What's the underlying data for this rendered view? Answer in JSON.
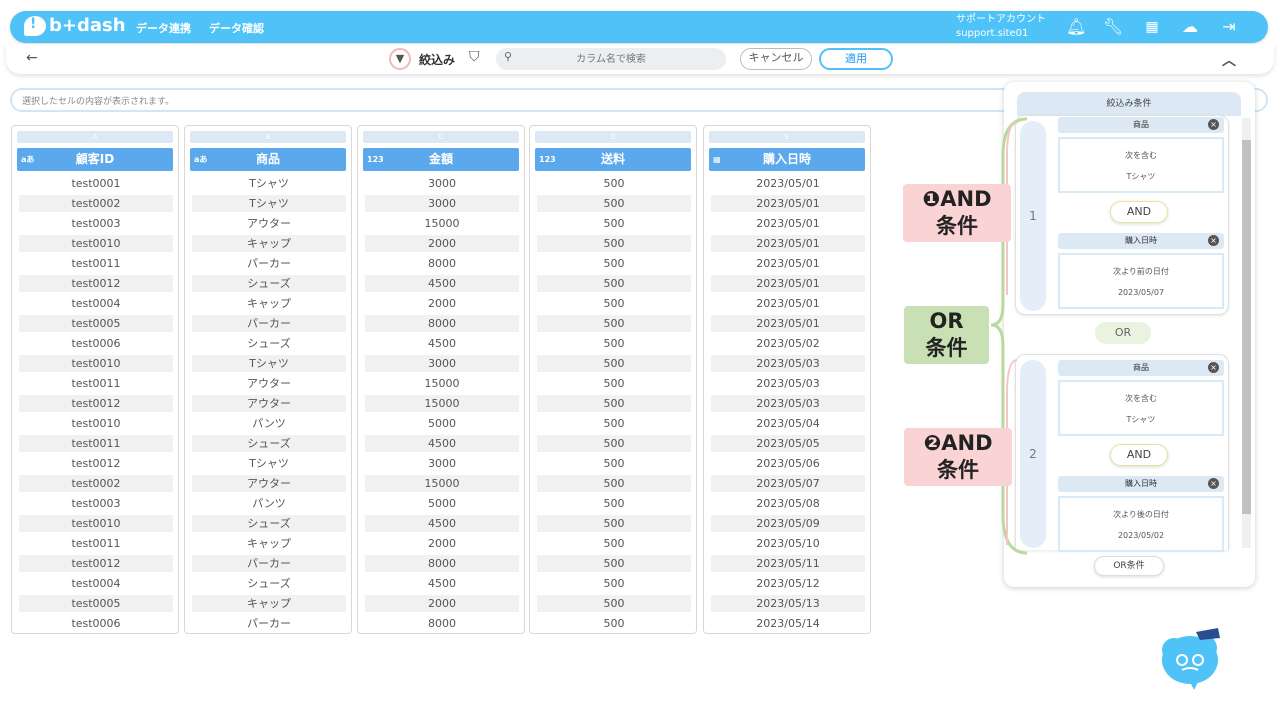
{
  "header": {
    "logo": "b+dash",
    "nav": [
      "データ連携",
      "データ確認"
    ],
    "account_label": "サポートアカウント",
    "account_id": "support.site01"
  },
  "toolbar": {
    "back": "←",
    "filter_label": "絞込み",
    "search_placeholder": "カラム名で検索",
    "cancel": "キャンセル",
    "apply": "適用",
    "collapse": "⌃"
  },
  "cell_bar": "選択したセルの内容が表示されます。",
  "columns": [
    {
      "letter": "A",
      "type": "aあ",
      "name": "顧客ID"
    },
    {
      "letter": "B",
      "type": "aあ",
      "name": "商品"
    },
    {
      "letter": "C",
      "type": "123",
      "name": "金額"
    },
    {
      "letter": "D",
      "type": "123",
      "name": "送料"
    },
    {
      "letter": "E",
      "type": "▦",
      "name": "購入日時"
    }
  ],
  "rows": [
    [
      "test0001",
      "Tシャツ",
      "3000",
      "500",
      "2023/05/01"
    ],
    [
      "test0002",
      "Tシャツ",
      "3000",
      "500",
      "2023/05/01"
    ],
    [
      "test0003",
      "アウター",
      "15000",
      "500",
      "2023/05/01"
    ],
    [
      "test0010",
      "キャップ",
      "2000",
      "500",
      "2023/05/01"
    ],
    [
      "test0011",
      "パーカー",
      "8000",
      "500",
      "2023/05/01"
    ],
    [
      "test0012",
      "シューズ",
      "4500",
      "500",
      "2023/05/01"
    ],
    [
      "test0004",
      "キャップ",
      "2000",
      "500",
      "2023/05/01"
    ],
    [
      "test0005",
      "パーカー",
      "8000",
      "500",
      "2023/05/01"
    ],
    [
      "test0006",
      "シューズ",
      "4500",
      "500",
      "2023/05/02"
    ],
    [
      "test0010",
      "Tシャツ",
      "3000",
      "500",
      "2023/05/03"
    ],
    [
      "test0011",
      "アウター",
      "15000",
      "500",
      "2023/05/03"
    ],
    [
      "test0012",
      "アウター",
      "15000",
      "500",
      "2023/05/03"
    ],
    [
      "test0010",
      "パンツ",
      "5000",
      "500",
      "2023/05/04"
    ],
    [
      "test0011",
      "シューズ",
      "4500",
      "500",
      "2023/05/05"
    ],
    [
      "test0012",
      "Tシャツ",
      "3000",
      "500",
      "2023/05/06"
    ],
    [
      "test0002",
      "アウター",
      "15000",
      "500",
      "2023/05/07"
    ],
    [
      "test0003",
      "パンツ",
      "5000",
      "500",
      "2023/05/08"
    ],
    [
      "test0010",
      "シューズ",
      "4500",
      "500",
      "2023/05/09"
    ],
    [
      "test0011",
      "キャップ",
      "2000",
      "500",
      "2023/05/10"
    ],
    [
      "test0012",
      "パーカー",
      "8000",
      "500",
      "2023/05/11"
    ],
    [
      "test0004",
      "シューズ",
      "4500",
      "500",
      "2023/05/12"
    ],
    [
      "test0005",
      "キャップ",
      "2000",
      "500",
      "2023/05/13"
    ],
    [
      "test0006",
      "パーカー",
      "8000",
      "500",
      "2023/05/14"
    ]
  ],
  "panel": {
    "title": "絞込み条件",
    "group1": {
      "num": "1",
      "c1_field": "商品",
      "c1_op": "次を含む",
      "c1_val": "Tシャツ",
      "and": "AND",
      "c2_field": "購入日時",
      "c2_op": "次より前の日付",
      "c2_val": "2023/05/07"
    },
    "or": "OR",
    "group2": {
      "num": "2",
      "c1_field": "商品",
      "c1_op": "次を含む",
      "c1_val": "Tシャツ",
      "and": "AND",
      "c2_field": "購入日時",
      "c2_op": "次より後の日付",
      "c2_val": "2023/05/02"
    },
    "or_button": "OR条件"
  },
  "annotations": {
    "and1_l1": "❶AND",
    "and1_l2": "条件",
    "or_l1": "OR",
    "or_l2": "条件",
    "and2_l1": "❷AND",
    "and2_l2": "条件"
  },
  "colors": {
    "brand": "#4fc3f7",
    "header_blue": "#5ba8ec",
    "and_ann": "#fad4d4",
    "or_ann": "#c8e0b4"
  }
}
